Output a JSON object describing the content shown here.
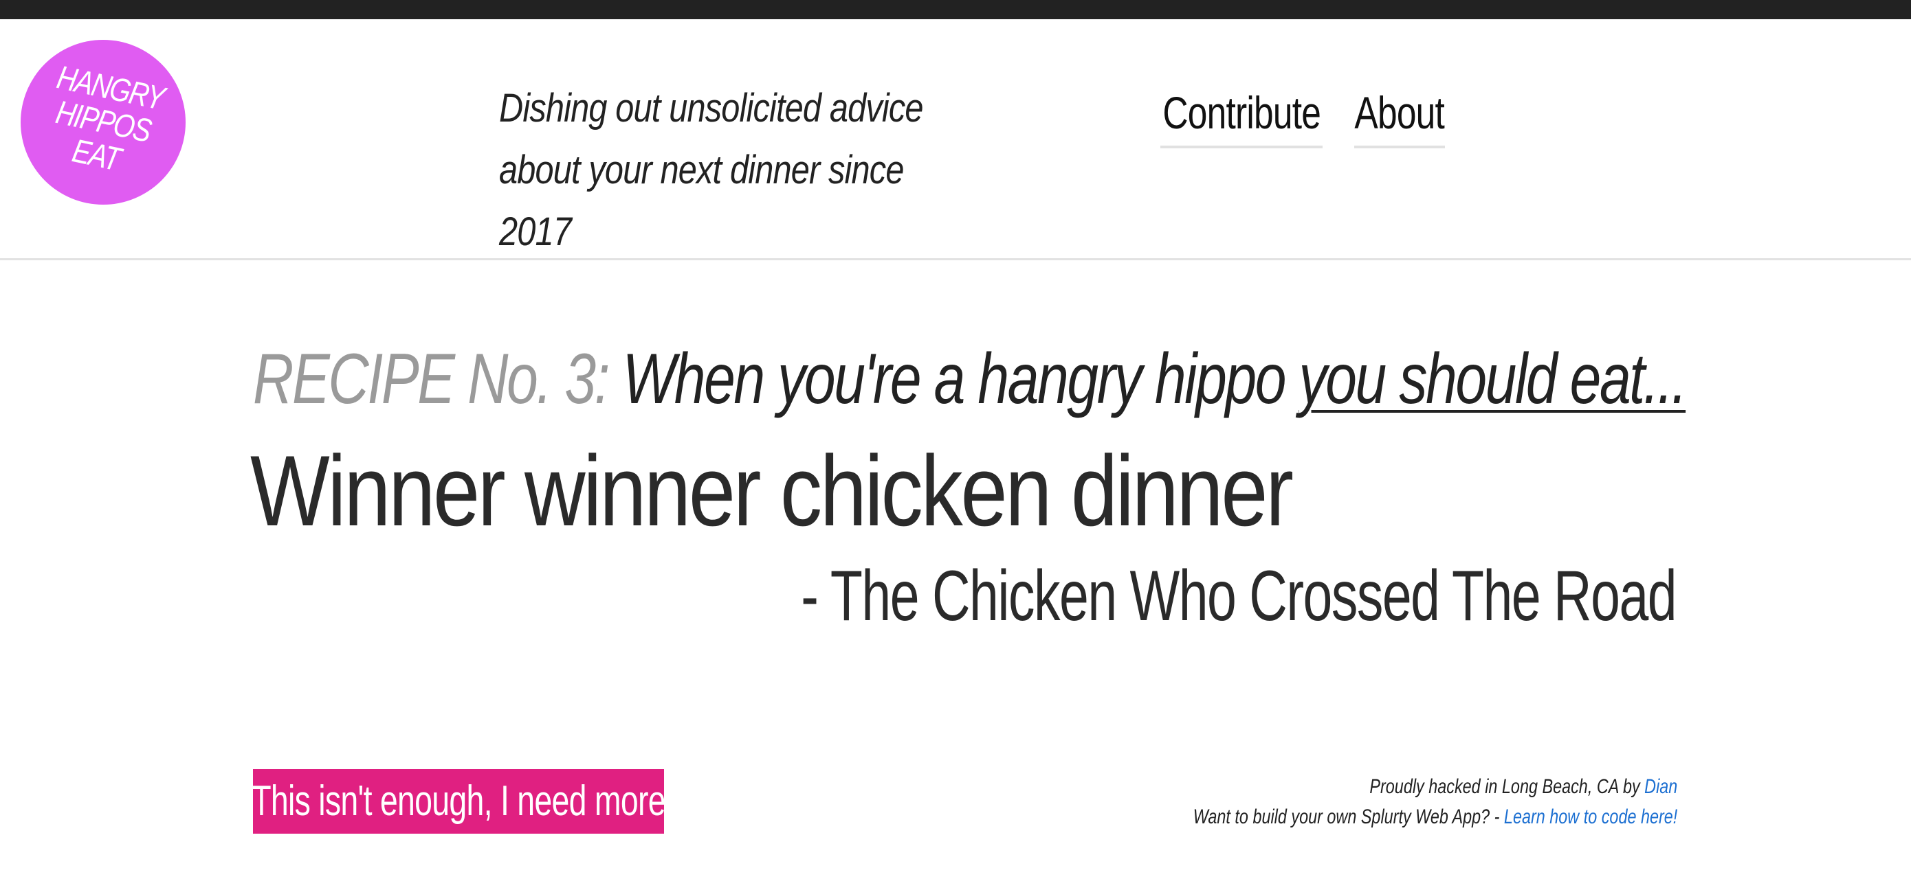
{
  "site": {
    "logo_text": "HANGRY\nHIPPOS\nEAT",
    "tagline": "Dishing out unsolicited advice about your next dinner since 2017"
  },
  "nav": {
    "items": [
      {
        "label": "Contribute"
      },
      {
        "label": "About"
      }
    ]
  },
  "recipe": {
    "label": "RECIPE No. 3:",
    "lead": "When you're a hangry hippo ",
    "link": "you should eat...",
    "headline": "Winner winner chicken dinner",
    "attribution": "- The Chicken Who Crossed The Road"
  },
  "actions": {
    "more_label": "This isn't enough, I need more"
  },
  "footer": {
    "line1_text": "Proudly hacked in Long Beach, CA by ",
    "line1_link": "Dian",
    "line2_text": "Want to build your own Splurty Web App? - ",
    "line2_link": "Learn how to code here!"
  },
  "colors": {
    "logo_bg": "#e05cf2",
    "button_bg": "#e02081",
    "link": "#1c6fd1",
    "top_bar": "#222222"
  }
}
